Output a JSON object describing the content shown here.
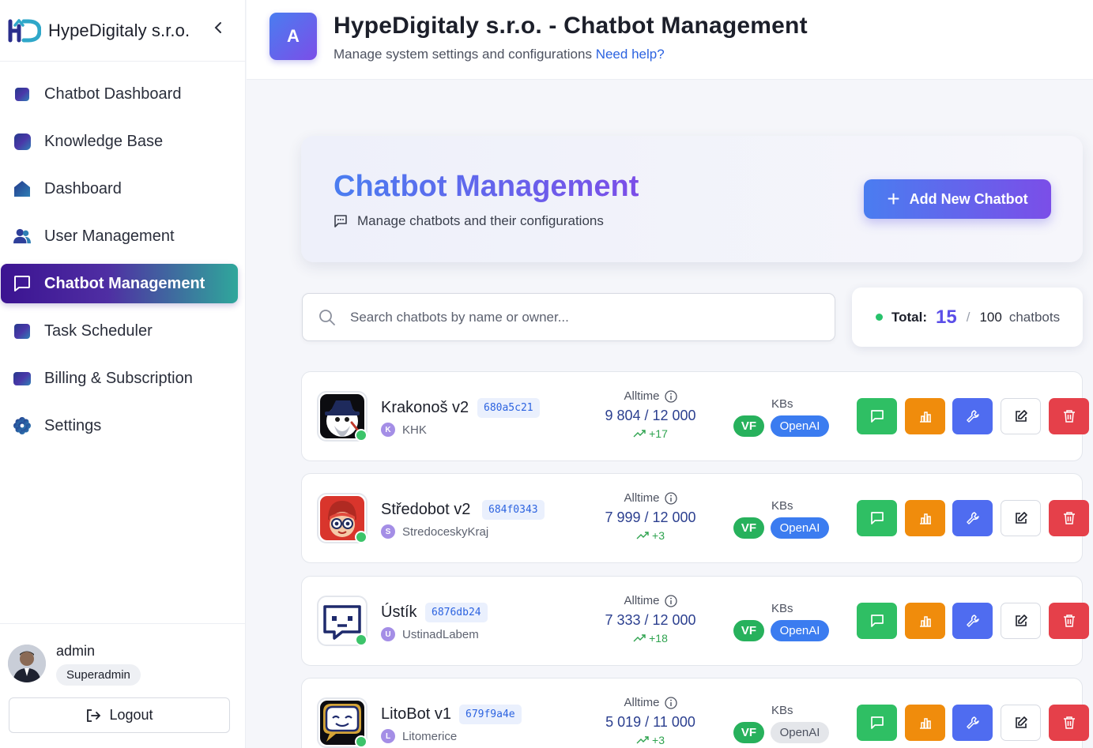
{
  "sidebar": {
    "brand_name": "HypeDigitaly s.r.o.",
    "brand_logo": "hd-logo",
    "items": [
      {
        "label": "Chatbot Dashboard",
        "icon": "chatbot-dashboard-icon",
        "active": false
      },
      {
        "label": "Knowledge Base",
        "icon": "knowledge-base-icon",
        "active": false
      },
      {
        "label": "Dashboard",
        "icon": "home-icon",
        "active": false
      },
      {
        "label": "User Management",
        "icon": "users-icon",
        "active": false
      },
      {
        "label": "Chatbot Management",
        "icon": "chat-bubble-icon",
        "active": true
      },
      {
        "label": "Task Scheduler",
        "icon": "task-scheduler-icon",
        "active": false
      },
      {
        "label": "Billing & Subscription",
        "icon": "billing-icon",
        "active": false
      },
      {
        "label": "Settings",
        "icon": "gear-icon",
        "active": false
      }
    ],
    "user": {
      "name": "admin",
      "role": "Superadmin"
    },
    "logout_label": "Logout"
  },
  "header": {
    "avatar_letter": "A",
    "title": "HypeDigitaly s.r.o. - Chatbot Management",
    "subtitle": "Manage system settings and configurations",
    "help_link": "Need help?"
  },
  "hero": {
    "title": "Chatbot Management",
    "subtitle": "Manage chatbots and their configurations",
    "add_button": "Add New Chatbot"
  },
  "search": {
    "placeholder": "Search chatbots by name or owner..."
  },
  "total": {
    "label": "Total:",
    "count": "15",
    "separator": "/",
    "max": "100",
    "unit": "chatbots"
  },
  "bots": [
    {
      "name": "Krakonoš v2",
      "id": "680a5c21",
      "owner_initial": "K",
      "owner": "KHK",
      "alltime_label": "Alltime",
      "alltime": "9 804 / 12 000",
      "trend": "+17",
      "kbs_label": "KBs",
      "vf": "VF",
      "openai": "OpenAI",
      "openai_active": true
    },
    {
      "name": "Středobot v2",
      "id": "684f0343",
      "owner_initial": "S",
      "owner": "StredoceskyKraj",
      "alltime_label": "Alltime",
      "alltime": "7 999 / 12 000",
      "trend": "+3",
      "kbs_label": "KBs",
      "vf": "VF",
      "openai": "OpenAI",
      "openai_active": true
    },
    {
      "name": "Ústík",
      "id": "6876db24",
      "owner_initial": "U",
      "owner": "UstinadLabem",
      "alltime_label": "Alltime",
      "alltime": "7 333 / 12 000",
      "trend": "+18",
      "kbs_label": "KBs",
      "vf": "VF",
      "openai": "OpenAI",
      "openai_active": true
    },
    {
      "name": "LitoBot v1",
      "id": "679f9a4e",
      "owner_initial": "L",
      "owner": "Litomerice",
      "alltime_label": "Alltime",
      "alltime": "5 019 / 11 000",
      "trend": "+3",
      "kbs_label": "KBs",
      "vf": "VF",
      "openai": "OpenAI",
      "openai_active": false
    }
  ],
  "colors": {
    "accent_start": "#4a7df0",
    "accent_end": "#7b4ee8",
    "active_nav_start": "#3b1391",
    "active_nav_end": "#2fa79b",
    "chat": "#2fbf64",
    "stats": "#f08c0c",
    "tool": "#4f6cf0",
    "delete": "#e5404a"
  }
}
